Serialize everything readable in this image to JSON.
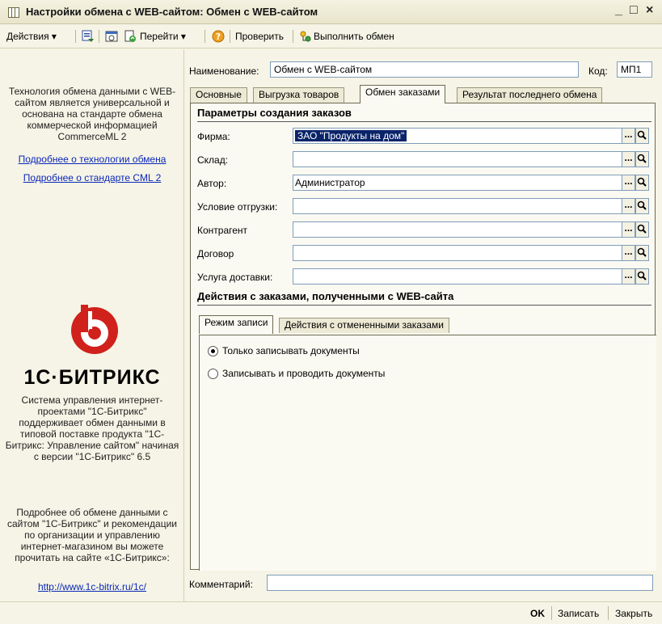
{
  "window": {
    "title": "Настройки обмена с WEB-сайтом: Обмен с WEB-сайтом",
    "minimize": "_",
    "maximize": "□",
    "close": "×"
  },
  "toolbar": {
    "actions": "Действия ▾",
    "goto": "Перейти ▾",
    "check": "Проверить",
    "execute": "Выполнить обмен"
  },
  "sidebar": {
    "intro": "Технология обмена данными с WEB-сайтом является универсальной и основана на стандарте обмена коммерческой информацией CommerceML 2",
    "link_tech": "Подробнее о технологии обмена",
    "link_cml": "Подробнее о стандарте CML 2",
    "brand": "1С·БИТРИКС",
    "about": "Система управления интернет-проектами \"1С-Битрикс\" поддерживает обмен данными в типовой поставке продукта \"1С-Битрикс: Управление сайтом\" начиная с версии \"1С-Битрикс\" 6.5",
    "more": "Подробнее об обмене данными с сайтом \"1С-Битрикс\" и рекомендации по организации и управлению интернет-магазином вы можете прочитать на сайте «1С-Битрикс»:",
    "url": "http://www.1c-bitrix.ru/1c/"
  },
  "header": {
    "name_label": "Наименование:",
    "name_value": "Обмен с WEB-сайтом",
    "code_label": "Код:",
    "code_value": "МП1"
  },
  "tabs": [
    {
      "label": "Основные"
    },
    {
      "label": "Выгрузка товаров"
    },
    {
      "label": "Обмен заказами"
    },
    {
      "label": "Результат последнего обмена"
    }
  ],
  "orders": {
    "section1": "Параметры создания заказов",
    "fields": [
      {
        "label": "Фирма:",
        "value": "ЗАО \"Продукты на дом\""
      },
      {
        "label": "Склад:",
        "value": ""
      },
      {
        "label": "Автор:",
        "value": "Администратор"
      },
      {
        "label": "Условие отгрузки:",
        "value": ""
      },
      {
        "label": "Контрагент",
        "value": ""
      },
      {
        "label": "Договор",
        "value": ""
      },
      {
        "label": "Услуга доставки:",
        "value": ""
      }
    ],
    "pick": "...",
    "section2": "Действия с заказами, полученными с WEB-сайта",
    "subtabs": [
      {
        "label": "Режим записи"
      },
      {
        "label": "Действия с отмененными заказами"
      }
    ],
    "radio1": "Только записывать документы",
    "radio2": "Записывать и проводить документы"
  },
  "footer": {
    "comment_label": "Комментарий:",
    "comment_value": ""
  },
  "buttons": {
    "ok": "OK",
    "save": "Записать",
    "close": "Закрыть"
  }
}
